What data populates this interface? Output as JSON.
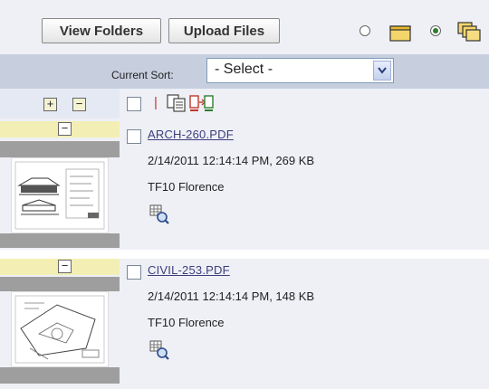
{
  "toolbar": {
    "view_folders_label": "View Folders",
    "upload_files_label": "Upload Files",
    "view_modes": [
      {
        "name": "list-view",
        "selected": false
      },
      {
        "name": "thumbnail-view",
        "selected": true
      }
    ]
  },
  "sort": {
    "label": "Current Sort:",
    "selected_option": "- Select -"
  },
  "controls": {
    "expand_symbol": "+",
    "collapse_symbol": "−",
    "separator": "|",
    "icons": [
      "copy-icon",
      "move-icon"
    ]
  },
  "files": [
    {
      "name": "ARCH-260.PDF",
      "modified": "2/14/2011 12:14:14 PM, 269 KB",
      "location": "TF10 Florence",
      "collapse_symbol": "−"
    },
    {
      "name": "CIVIL-253.PDF",
      "modified": "2/14/2011 12:14:14 PM, 148 KB",
      "location": "TF10 Florence",
      "collapse_symbol": "−"
    }
  ],
  "colors": {
    "toolbar_bg": "#eef0f6",
    "sort_bar_bg": "#c7cfdf",
    "item_header_bg": "#f3efb4",
    "link_color": "#3d3d7c",
    "radio_selected": "#2f7d2f"
  }
}
